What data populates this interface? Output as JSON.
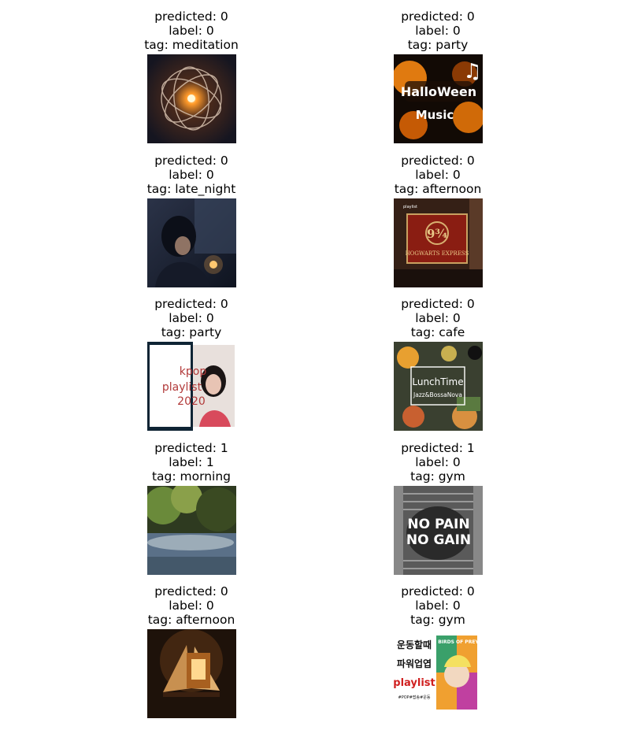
{
  "panels": [
    {
      "predicted": "predicted: 0",
      "label": "label: 0",
      "tag": "tag: meditation"
    },
    {
      "predicted": "predicted: 0",
      "label": "label: 0",
      "tag": "tag: party",
      "image_text": [
        "HalloWeen",
        "Music",
        "♫"
      ]
    },
    {
      "predicted": "predicted: 0",
      "label": "label: 0",
      "tag": "tag: late_night"
    },
    {
      "predicted": "predicted: 0",
      "label": "label: 0",
      "tag": "tag: afternoon",
      "image_text": [
        "9¾",
        "HOGWARTS EXPRESS",
        "playlist"
      ]
    },
    {
      "predicted": "predicted: 0",
      "label": "label: 0",
      "tag": "tag: party",
      "image_text": [
        "kpop",
        "playlist",
        "2020"
      ]
    },
    {
      "predicted": "predicted: 0",
      "label": "label: 0",
      "tag": "tag: cafe",
      "image_text": [
        "LunchTime",
        "Jazz&BossaNova"
      ]
    },
    {
      "predicted": "predicted: 1",
      "label": "label: 1",
      "tag": "tag: morning"
    },
    {
      "predicted": "predicted: 1",
      "label": "label: 0",
      "tag": "tag: gym",
      "image_text": [
        "NO PAIN",
        "NO GAIN"
      ]
    },
    {
      "predicted": "predicted: 0",
      "label": "label: 0",
      "tag": "tag: afternoon"
    },
    {
      "predicted": "predicted: 0",
      "label": "label: 0",
      "tag": "tag: gym",
      "image_text": [
        "운동할때",
        "파워업엽",
        "playlist",
        "#POP#팝송#운동",
        "BIRDS OF PREY"
      ]
    }
  ]
}
